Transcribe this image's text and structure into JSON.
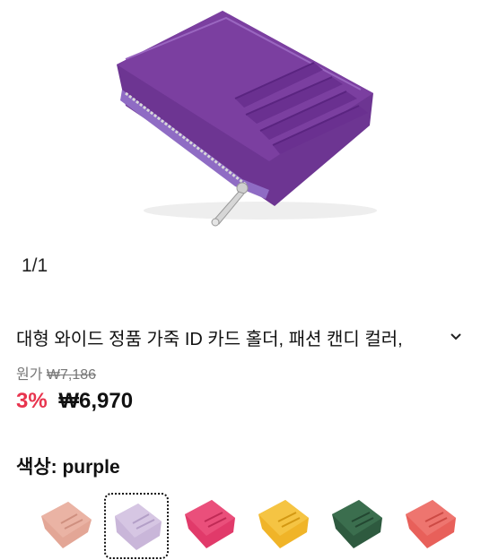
{
  "gallery": {
    "counter": "1/1"
  },
  "product": {
    "title": "대형 와이드 정품 가죽 ID 카드 홀더, 패션 캔디 컬러,",
    "original_price_label": "원가",
    "original_price": "₩7,186",
    "discount": "3%",
    "price": "₩6,970",
    "color_label": "색상: purple"
  },
  "colors": {
    "main_purple": "#7b3fa0",
    "discount_red": "#e8344e"
  },
  "swatches": [
    {
      "color": "#e3a696",
      "icon": "wallet-pink-beige"
    },
    {
      "color": "#c9b6d9",
      "icon": "wallet-lavender"
    },
    {
      "color": "#e13a6a",
      "icon": "wallet-magenta"
    },
    {
      "color": "#f0b428",
      "icon": "wallet-yellow"
    },
    {
      "color": "#2e5a3f",
      "icon": "wallet-dark-green"
    },
    {
      "color": "#e8605a",
      "icon": "wallet-coral"
    }
  ]
}
